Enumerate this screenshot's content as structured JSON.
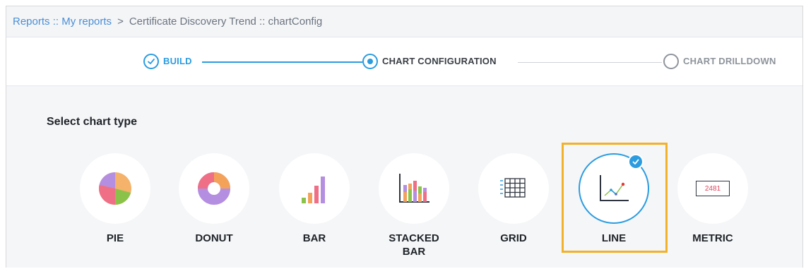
{
  "breadcrumb": {
    "root": "Reports",
    "root_sep": " :: ",
    "parent": "My reports",
    "separator": ">",
    "current": "Certificate Discovery Trend :: chartConfig"
  },
  "stepper": {
    "steps": [
      {
        "label": "BUILD",
        "state": "done"
      },
      {
        "label": "CHART CONFIGURATION",
        "state": "active"
      },
      {
        "label": "CHART DRILLDOWN",
        "state": "pending"
      }
    ]
  },
  "content": {
    "title": "Select chart type",
    "chart_types": [
      {
        "label": "PIE",
        "icon": "pie-chart-icon",
        "selected": false
      },
      {
        "label": "DONUT",
        "icon": "donut-chart-icon",
        "selected": false
      },
      {
        "label": "BAR",
        "icon": "bar-chart-icon",
        "selected": false
      },
      {
        "label": "STACKED",
        "label2": "BAR",
        "icon": "stacked-bar-chart-icon",
        "selected": false
      },
      {
        "label": "GRID",
        "icon": "grid-icon",
        "selected": false
      },
      {
        "label": "LINE",
        "icon": "line-chart-icon",
        "selected": true
      },
      {
        "label": "METRIC",
        "icon": "metric-icon",
        "metric_value": "2481",
        "selected": false
      }
    ]
  },
  "colors": {
    "accent": "#2b9ce0",
    "selection": "#f2b12b",
    "link": "#4a8fd6"
  }
}
